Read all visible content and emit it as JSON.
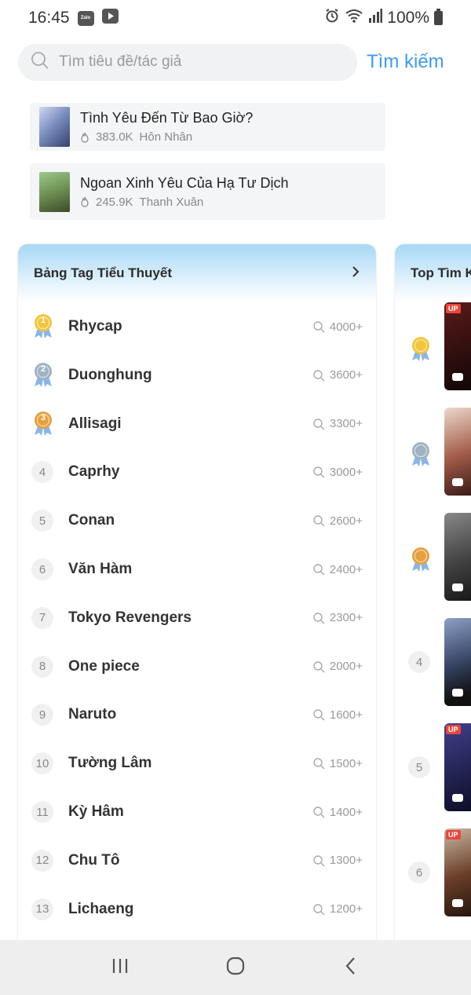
{
  "status_bar": {
    "time": "16:45",
    "app_badge_1": "Zalo",
    "battery": "100%"
  },
  "search": {
    "placeholder": "Tìm tiêu đề/tác giả",
    "button_label": "Tìm kiếm"
  },
  "novels": [
    {
      "title": "Tình Yêu Đến Từ Bao Giờ?",
      "views": "383.0K",
      "genre": "Hôn Nhân"
    },
    {
      "title": "Ngoan Xinh Yêu Của Hạ Tư Dịch",
      "views": "245.9K",
      "genre": "Thanh Xuân"
    }
  ],
  "tag_panel": {
    "title": "Bảng Tag Tiểu Thuyết",
    "rows": [
      {
        "rank": "1",
        "name": "Rhycap",
        "count": "4000+"
      },
      {
        "rank": "2",
        "name": "Duonghung",
        "count": "3600+"
      },
      {
        "rank": "3",
        "name": "Allisagi",
        "count": "3300+"
      },
      {
        "rank": "4",
        "name": "Caprhy",
        "count": "3000+"
      },
      {
        "rank": "5",
        "name": "Conan",
        "count": "2600+"
      },
      {
        "rank": "6",
        "name": "Văn Hàm",
        "count": "2400+"
      },
      {
        "rank": "7",
        "name": "Tokyo Revengers",
        "count": "2300+"
      },
      {
        "rank": "8",
        "name": "One piece",
        "count": "2000+"
      },
      {
        "rank": "9",
        "name": "Naruto",
        "count": "1600+"
      },
      {
        "rank": "10",
        "name": "Tường Lâm",
        "count": "1500+"
      },
      {
        "rank": "11",
        "name": "Kỳ Hâm",
        "count": "1400+"
      },
      {
        "rank": "12",
        "name": "Chu Tô",
        "count": "1300+"
      },
      {
        "rank": "13",
        "name": "Lichaeng",
        "count": "1200+"
      }
    ]
  },
  "top_panel": {
    "title": "Top Tìm K",
    "rows": [
      {
        "rank": "1",
        "up": "UP"
      },
      {
        "rank": "2",
        "up": ""
      },
      {
        "rank": "3",
        "up": ""
      },
      {
        "rank": "4",
        "up": ""
      },
      {
        "rank": "5",
        "up": "UP"
      },
      {
        "rank": "6",
        "up": "UP"
      }
    ]
  },
  "colors": {
    "accent": "#3d9be9",
    "gold": "#f2c53d",
    "silver": "#9fb2c3",
    "bronze": "#e6a040"
  }
}
